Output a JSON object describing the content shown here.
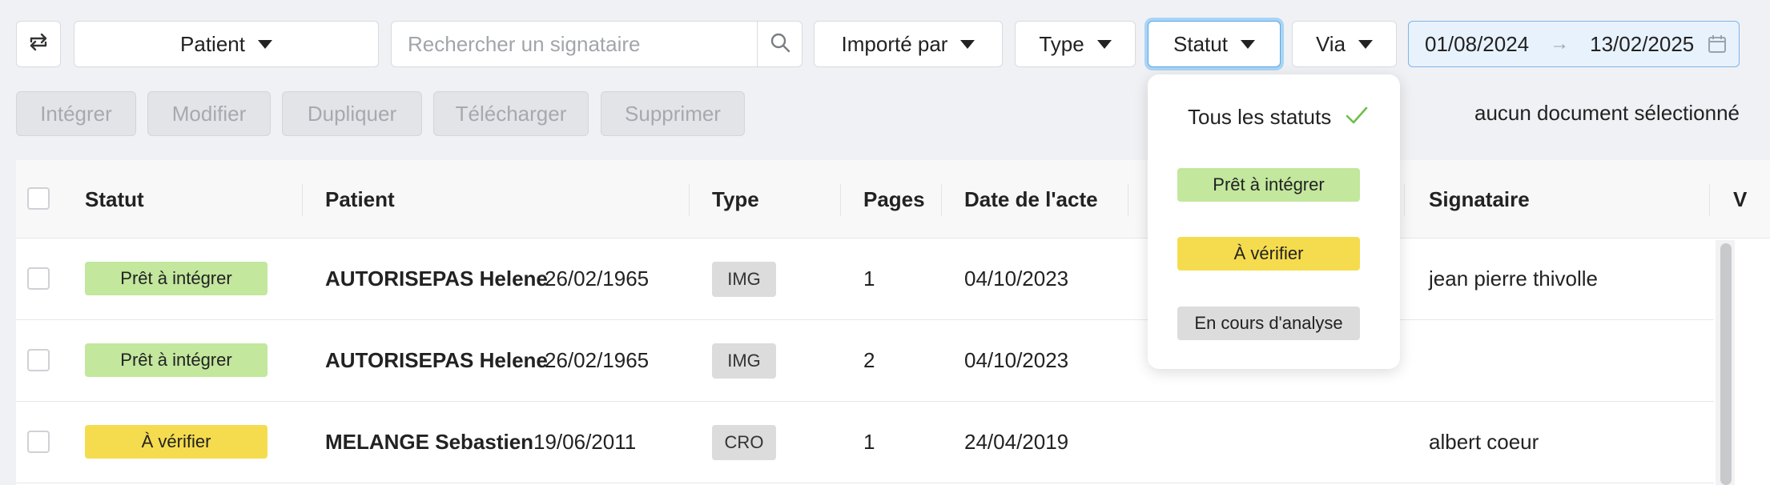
{
  "filters": {
    "patient_label": "Patient",
    "search_placeholder": "Rechercher un signataire",
    "imported_by_label": "Importé par",
    "type_label": "Type",
    "status_label": "Statut",
    "via_label": "Via",
    "date_from": "01/08/2024",
    "date_arrow": "→",
    "date_to": "13/02/2025"
  },
  "actions": {
    "integrate": "Intégrer",
    "modify": "Modifier",
    "duplicate": "Dupliquer",
    "download": "Télécharger",
    "delete": "Supprimer",
    "selection_info": "aucun document sélectionné"
  },
  "table": {
    "headers": {
      "status": "Statut",
      "patient": "Patient",
      "type": "Type",
      "pages": "Pages",
      "date": "Date de l'acte",
      "signatory": "Signataire",
      "extra": "V"
    },
    "rows": [
      {
        "status": "Prêt à intégrer",
        "status_color": "#c2e79d",
        "patient_name": "AUTORISEPAS Helene",
        "birthdate": "26/02/1965",
        "type": "IMG",
        "pages": "1",
        "date": "04/10/2023",
        "signatory": "jean pierre thivolle"
      },
      {
        "status": "Prêt à intégrer",
        "status_color": "#c2e79d",
        "patient_name": "AUTORISEPAS Helene",
        "birthdate": "26/02/1965",
        "type": "IMG",
        "pages": "2",
        "date": "04/10/2023",
        "signatory": ""
      },
      {
        "status": "À vérifier",
        "status_color": "#f5dc4e",
        "patient_name": "MELANGE Sebastien",
        "birthdate": "19/06/2011",
        "type": "CRO",
        "pages": "1",
        "date": "24/04/2019",
        "signatory": "albert coeur"
      }
    ]
  },
  "status_dropdown": {
    "all": "Tous les statuts",
    "options": [
      {
        "label": "Prêt à intégrer",
        "color": "#c2e79d"
      },
      {
        "label": "À vérifier",
        "color": "#f5dc4e"
      },
      {
        "label": "En cours d'analyse",
        "color": "#dcdcdc"
      }
    ]
  },
  "colors": {
    "accent_blue": "#5aa7e6",
    "check_green": "#6cc04a"
  }
}
